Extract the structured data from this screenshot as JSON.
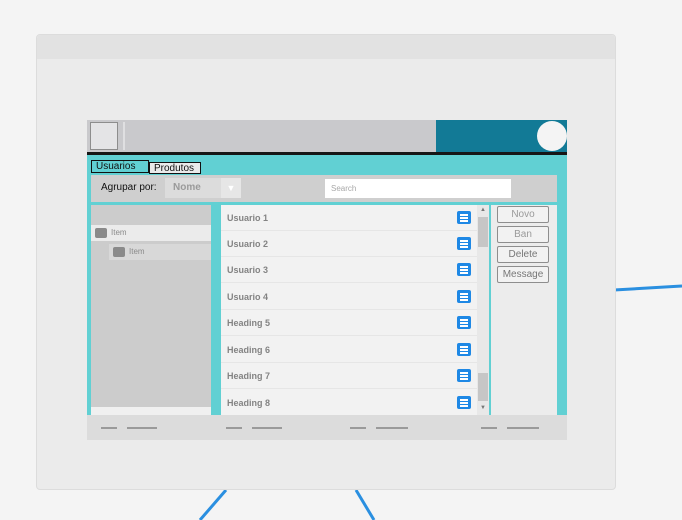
{
  "tabs": [
    {
      "label": "Usuarios",
      "active": true
    },
    {
      "label": "Produtos",
      "active": false
    }
  ],
  "filter": {
    "group_label": "Agrupar por:",
    "group_value": "Nome",
    "search_placeholder": "Search"
  },
  "tree": {
    "items": [
      {
        "label": "Item",
        "level": 0
      },
      {
        "label": "Item",
        "level": 1
      }
    ]
  },
  "list": {
    "rows": [
      {
        "label": "Usuario 1"
      },
      {
        "label": "Usuario 2"
      },
      {
        "label": "Usuario 3"
      },
      {
        "label": "Usuario 4"
      },
      {
        "label": "Heading 5"
      },
      {
        "label": "Heading 6"
      },
      {
        "label": "Heading 7"
      },
      {
        "label": "Heading 8"
      }
    ],
    "row_icon": "list-menu-icon"
  },
  "actions": {
    "novo": "Novo",
    "ban": "Ban",
    "delete": "Delete",
    "message": "Message"
  },
  "colors": {
    "accent_teal": "#61d0d3",
    "brand_blue": "#127a96",
    "icon_blue": "#1e88e5",
    "connector": "#2a8fe0"
  }
}
